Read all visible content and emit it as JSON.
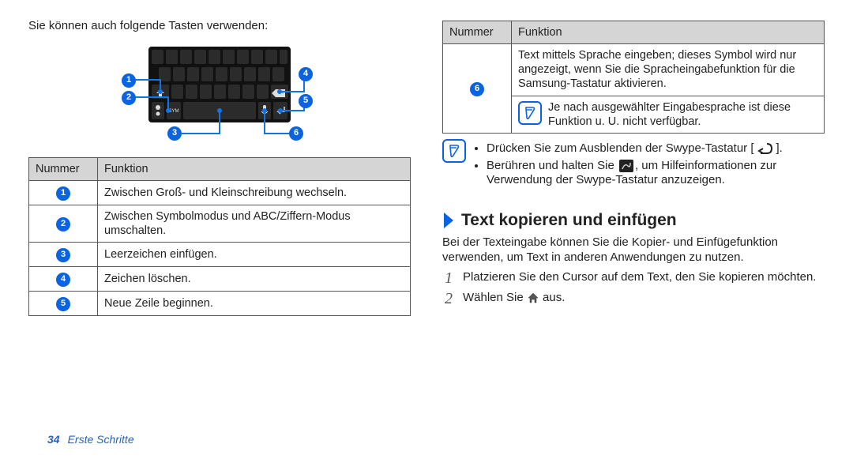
{
  "left": {
    "intro": "Sie können auch folgende Tasten verwenden:",
    "table_header_num": "Nummer",
    "table_header_func": "Funktion",
    "rows": [
      {
        "n": "1",
        "t": "Zwischen Groß- und Kleinschreibung wechseln."
      },
      {
        "n": "2",
        "t": "Zwischen Symbolmodus und ABC/Ziffern-Modus umschalten."
      },
      {
        "n": "3",
        "t": "Leerzeichen einfügen."
      },
      {
        "n": "4",
        "t": "Zeichen löschen."
      },
      {
        "n": "5",
        "t": "Neue Zeile beginnen."
      }
    ],
    "callouts": [
      "1",
      "2",
      "3",
      "4",
      "5",
      "6"
    ]
  },
  "right": {
    "table_header_num": "Nummer",
    "table_header_func": "Funktion",
    "row6_n": "6",
    "row6_t": "Text mittels Sprache eingeben; dieses Symbol wird nur angezeigt, wenn Sie die Spracheingabefunktion für die Samsung-Tastatur aktivieren.",
    "row6_note": "Je nach ausgewählter Eingabesprache ist diese Funktion u. U. nicht verfügbar.",
    "bullets_prefix1": "Drücken Sie zum Ausblenden der Swype-Tastatur [",
    "bullets_suffix1": "].",
    "bullets_prefix2": "Berühren und halten Sie ",
    "bullets_suffix2": ", um Hilfeinformationen zur Verwendung der Swype-Tastatur anzuzeigen.",
    "section_title": "Text kopieren und einfügen",
    "section_body": "Bei der Texteingabe können Sie die Kopier- und Einfügefunktion verwenden, um Text in anderen Anwendungen zu nutzen.",
    "step1_n": "1",
    "step1_t": "Platzieren Sie den Cursor auf dem Text, den Sie kopieren möchten.",
    "step2_n": "2",
    "step2_prefix": "Wählen Sie ",
    "step2_suffix": " aus."
  },
  "footer": {
    "page": "34",
    "crumb": "Erste Schritte"
  }
}
